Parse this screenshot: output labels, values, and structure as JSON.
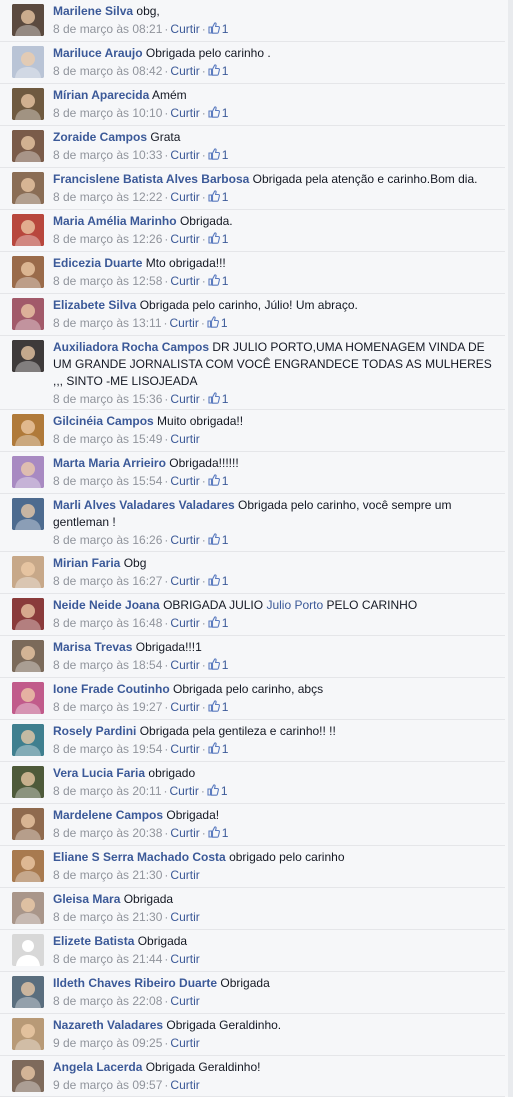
{
  "ui": {
    "like_label": "Curtir",
    "separator": "·"
  },
  "comments": [
    {
      "author": "Marilene Silva",
      "text": "obg,",
      "time": "8 de março às 08:21",
      "likes": "1",
      "avatar_color": "#5b4a3f"
    },
    {
      "author": "Mariluce Araujo",
      "text": "Obrigada pelo carinho .",
      "time": "8 de março às 08:42",
      "likes": "1",
      "avatar_color": "#b9c4d6"
    },
    {
      "author": "Mírian Aparecida",
      "text": "Amém",
      "time": "8 de março às 10:10",
      "likes": "1",
      "avatar_color": "#6f5a40"
    },
    {
      "author": "Zoraide Campos",
      "text": "Grata",
      "time": "8 de março às 10:33",
      "likes": "1",
      "avatar_color": "#7a5b49"
    },
    {
      "author": "Francislene Batista Alves Barbosa",
      "text": "Obrigada pela atenção e carinho.Bom dia.",
      "time": "8 de março às 12:22",
      "likes": "1",
      "avatar_color": "#8a6d55"
    },
    {
      "author": "Maria Amélia Marinho",
      "text": "Obrigada.",
      "time": "8 de março às 12:26",
      "likes": "1",
      "avatar_color": "#b8473d"
    },
    {
      "author": "Edicezia Duarte",
      "text": "Mto obrigada!!!",
      "time": "8 de março às 12:58",
      "likes": "1",
      "avatar_color": "#9a6b4a"
    },
    {
      "author": "Elizabete Silva",
      "text": "Obrigada pelo carinho, Júlio! Um abraço.",
      "time": "8 de março às 13:11",
      "likes": "1",
      "avatar_color": "#a25a6a"
    },
    {
      "author": "Auxiliadora Rocha Campos",
      "text": "DR JULIO PORTO,UMA HOMENAGEM VINDA DE UM GRANDE JORNALISTA COM VOCÊ ENGRANDECE TODAS AS MULHERES ,,, SINTO -ME LISOJEADA",
      "time": "8 de março às 15:36",
      "likes": "1",
      "avatar_color": "#3e3a3a"
    },
    {
      "author": "Gilcinéia Campos",
      "text": "Muito obrigada!!",
      "time": "8 de março às 15:49",
      "likes": "",
      "avatar_color": "#b07a3a"
    },
    {
      "author": "Marta Maria Arrieiro",
      "text": "Obrigada!!!!!!",
      "time": "8 de março às 15:54",
      "likes": "1",
      "avatar_color": "#a88ac2"
    },
    {
      "author": "Marli Alves Valadares Valadares",
      "text": "Obrigada pelo carinho, você sempre um gentleman !",
      "time": "8 de março às 16:26",
      "likes": "1",
      "avatar_color": "#4d6b8f"
    },
    {
      "author": "Mirian Faria",
      "text": "Obg",
      "time": "8 de março às 16:27",
      "likes": "1",
      "avatar_color": "#c7a889"
    },
    {
      "author": "Neide Neide Joana",
      "text": "OBRIGADA JULIO",
      "mention": "Julio Porto",
      "text2": "PELO CARINHO",
      "time": "8 de março às 16:48",
      "likes": "1",
      "avatar_color": "#8a3b3b"
    },
    {
      "author": "Marisa Trevas",
      "text": "Obrigada!!!1",
      "time": "8 de março às 18:54",
      "likes": "1",
      "avatar_color": "#7b6a5a"
    },
    {
      "author": "Ione Frade Coutinho",
      "text": "Obrigada pelo carinho, abçs",
      "time": "8 de março às 19:27",
      "likes": "1",
      "avatar_color": "#c15b8b"
    },
    {
      "author": "Rosely Pardini",
      "text": "Obrigada pela gentileza e carinho!! !!",
      "time": "8 de março às 19:54",
      "likes": "1",
      "avatar_color": "#3f7f8f"
    },
    {
      "author": "Vera Lucia Faria",
      "text": "obrigado",
      "time": "8 de março às 20:11",
      "likes": "1",
      "avatar_color": "#4e5a3a"
    },
    {
      "author": "Mardelene Campos",
      "text": "Obrigada!",
      "time": "8 de março às 20:38",
      "likes": "1",
      "avatar_color": "#8f6a4e"
    },
    {
      "author": "Eliane S Serra Machado Costa",
      "text": "obrigado pelo carinho",
      "time": "8 de março às 21:30",
      "likes": "",
      "avatar_color": "#a87a4f"
    },
    {
      "author": "Gleisa Mara",
      "text": "Obrigada",
      "time": "8 de março às 21:30",
      "likes": "",
      "avatar_color": "#a9968a"
    },
    {
      "author": "Elizete Batista",
      "text": "Obrigada",
      "time": "8 de março às 21:44",
      "likes": "",
      "avatar_color": "#d8d8d8",
      "default_avatar": true
    },
    {
      "author": "Ildeth Chaves Ribeiro Duarte",
      "text": "Obrigada",
      "time": "8 de março às 22:08",
      "likes": "",
      "avatar_color": "#5a6e7e"
    },
    {
      "author": "Nazareth Valadares",
      "text": "Obrigada Geraldinho.",
      "time": "9 de março às 09:25",
      "likes": "",
      "avatar_color": "#b89a77"
    },
    {
      "author": "Angela Lacerda",
      "text": "Obrigada Geraldinho!",
      "time": "9 de março às 09:57",
      "likes": "",
      "avatar_color": "#7e6a5b"
    }
  ]
}
